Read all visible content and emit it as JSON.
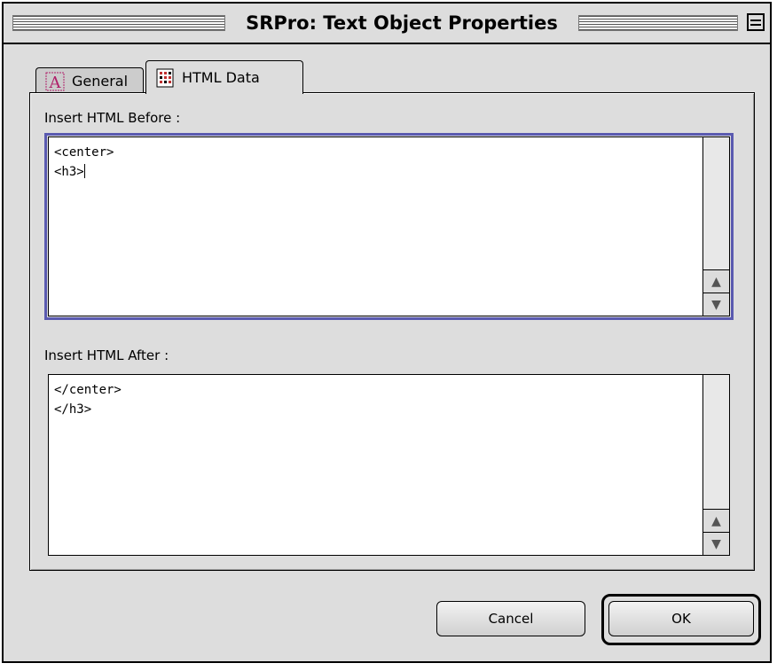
{
  "window": {
    "title": "SRPro: Text Object Properties"
  },
  "tabs": [
    {
      "label": "General",
      "icon": "font-a-icon",
      "active": false
    },
    {
      "label": "HTML Data",
      "icon": "html-grid-icon",
      "active": true
    }
  ],
  "before": {
    "label": "Insert HTML Before :",
    "lines": [
      "<center>",
      "<h3>"
    ]
  },
  "after": {
    "label": "Insert HTML After :",
    "lines": [
      "</center>",
      "</h3>"
    ]
  },
  "buttons": {
    "cancel": "Cancel",
    "ok": "OK"
  },
  "colors": {
    "focus_ring": "#5a5ab0",
    "general_icon": "#b0206a",
    "html_icon": "#c03030"
  }
}
